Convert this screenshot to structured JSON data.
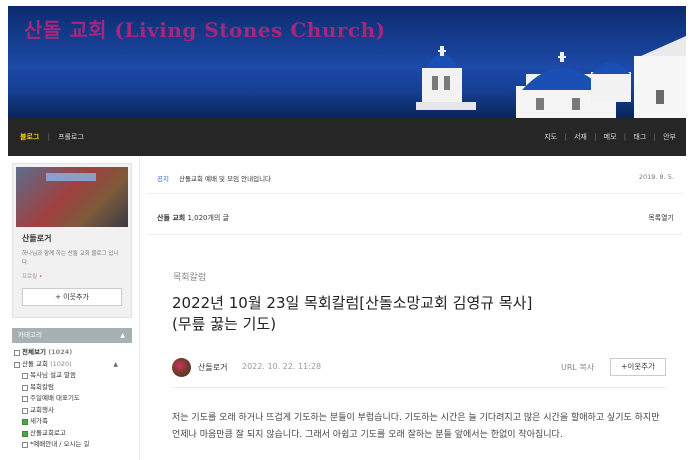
{
  "header": {
    "title": "산돌 교회 (Living Stones Church)"
  },
  "nav": {
    "blog": "블로그",
    "separator": "|",
    "prologue": "프롤로그",
    "right_items": [
      "지도",
      "서재",
      "메모",
      "태그",
      "안부"
    ]
  },
  "sidebar": {
    "profile_name": "산돌로거",
    "profile_desc": "하나님과 함께 하는 산돌 교회 블로그 입니다.",
    "profile_edit": "프로필",
    "follow_label": "+ 이웃추가",
    "category_header": "카테고리",
    "categories": [
      {
        "label": "전체보기",
        "count": "(1024)",
        "kind": "top"
      },
      {
        "label": "산돌 교회",
        "count": "(1020)",
        "kind": "grp"
      },
      {
        "label": "목사님 설교 말씀",
        "count": "",
        "kind": "sub"
      },
      {
        "label": "목회칼럼",
        "count": "",
        "kind": "sub"
      },
      {
        "label": "주일예배 대표기도",
        "count": "",
        "kind": "sub"
      },
      {
        "label": "교회행사",
        "count": "",
        "kind": "sub"
      },
      {
        "label": "새가족",
        "count": "",
        "kind": "sub",
        "icon": "green"
      },
      {
        "label": "산돌교회로고",
        "count": "",
        "kind": "sub",
        "icon": "green"
      },
      {
        "label": "*예배안내 / 오시는 길",
        "count": "",
        "kind": "sub"
      }
    ]
  },
  "notice": {
    "tag": "공지",
    "text": "산돌교회 예배 및 모임 안내입니다",
    "date": "2019. 8. 5."
  },
  "list_bar": {
    "blog_name": "산돌 교회",
    "count_text": "1,020개의 글",
    "open_label": "목록열기"
  },
  "post": {
    "category": "목회칼럼",
    "title_line1": "2022년 10월 23일 목회칼럼[산돌소망교회 김영규 목사]",
    "title_line2": "(무릎 꿇는 기도)",
    "author": "산돌로거",
    "date": "2022. 10. 22. 11:28",
    "url_copy": "URL 복사",
    "follow_label": "+이웃추가",
    "body": "저는 기도를 오래 하거나 뜨겁게 기도하는 분들이 부럽습니다. 기도하는 시간은 늘 기다려지고 많은 시간을 할애하고 싶기도 하지만 언제나 마음만큼 잘 되지 않습니다. 그래서 아쉽고 기도를 오래 잘하는 분들 앞에서는 한없이 작아집니다."
  },
  "colors": {
    "title_magenta": "#a3287d",
    "nav_bg": "#262626",
    "nav_active": "#f0d000",
    "notice_tag": "#2a6fd1",
    "follow_plus": "#2a9d4a"
  }
}
